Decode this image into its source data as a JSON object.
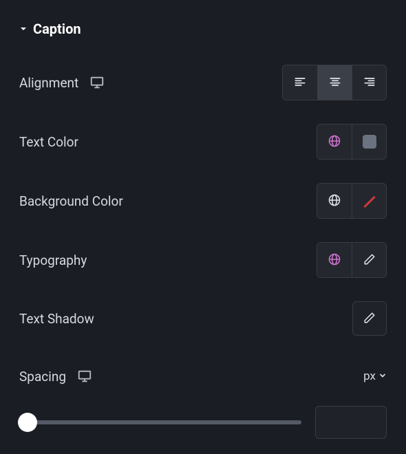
{
  "section": {
    "title": "Caption"
  },
  "labels": {
    "alignment": "Alignment",
    "textColor": "Text Color",
    "bgColor": "Background Color",
    "typography": "Typography",
    "textShadow": "Text Shadow",
    "spacing": "Spacing"
  },
  "alignment": {
    "value": "center"
  },
  "textColor": {
    "swatch": "#6b7280"
  },
  "spacing": {
    "unit": "px",
    "value": ""
  }
}
